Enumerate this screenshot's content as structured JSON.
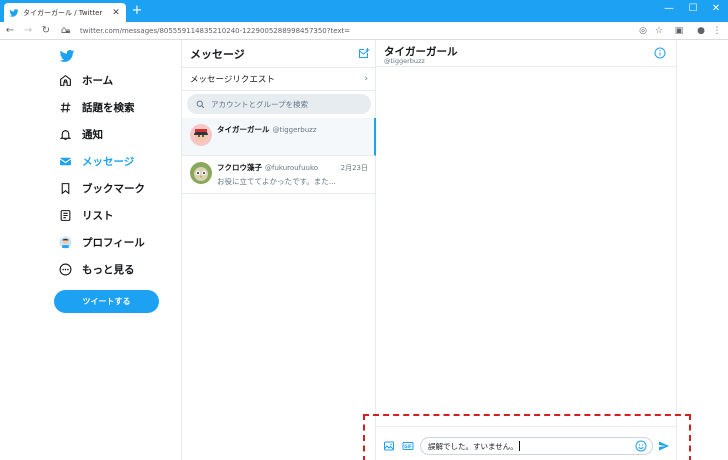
{
  "browser": {
    "tab_title": "タイガーガール / Twitter",
    "new_tab": "+",
    "url": "twitter.com/messages/805559114835210240-1229005288998457350?text=",
    "controls": {
      "minimize": "—",
      "maximize": "☐",
      "close": "✕"
    }
  },
  "nav": {
    "items": [
      {
        "label": "ホーム",
        "icon": "home-icon"
      },
      {
        "label": "話題を検索",
        "icon": "hashtag-icon"
      },
      {
        "label": "通知",
        "icon": "bell-icon"
      },
      {
        "label": "メッセージ",
        "icon": "envelope-icon",
        "active": true
      },
      {
        "label": "ブックマーク",
        "icon": "bookmark-icon"
      },
      {
        "label": "リスト",
        "icon": "list-icon"
      },
      {
        "label": "プロフィール",
        "icon": "avatar-icon"
      },
      {
        "label": "もっと見る",
        "icon": "more-icon"
      }
    ],
    "tweet_button": "ツイートする"
  },
  "messages": {
    "title": "メッセージ",
    "requests_label": "メッセージリクエスト",
    "search_placeholder": "アカウントとグループを検索",
    "conversations": [
      {
        "name": "タイガーガール",
        "handle": "@tiggerbuzz",
        "date": "",
        "preview": ""
      },
      {
        "name": "フクロウ藻子",
        "handle": "@fukuroufuuko",
        "date": "2月23日",
        "preview": "お役に立ててよかったです。また..."
      }
    ]
  },
  "chat": {
    "name": "タイガーガール",
    "handle": "@tiggerbuzz",
    "input_text": "誤解でした。すいません。"
  },
  "colors": {
    "accent": "#1da1f2",
    "highlight": "#d51f1f"
  }
}
